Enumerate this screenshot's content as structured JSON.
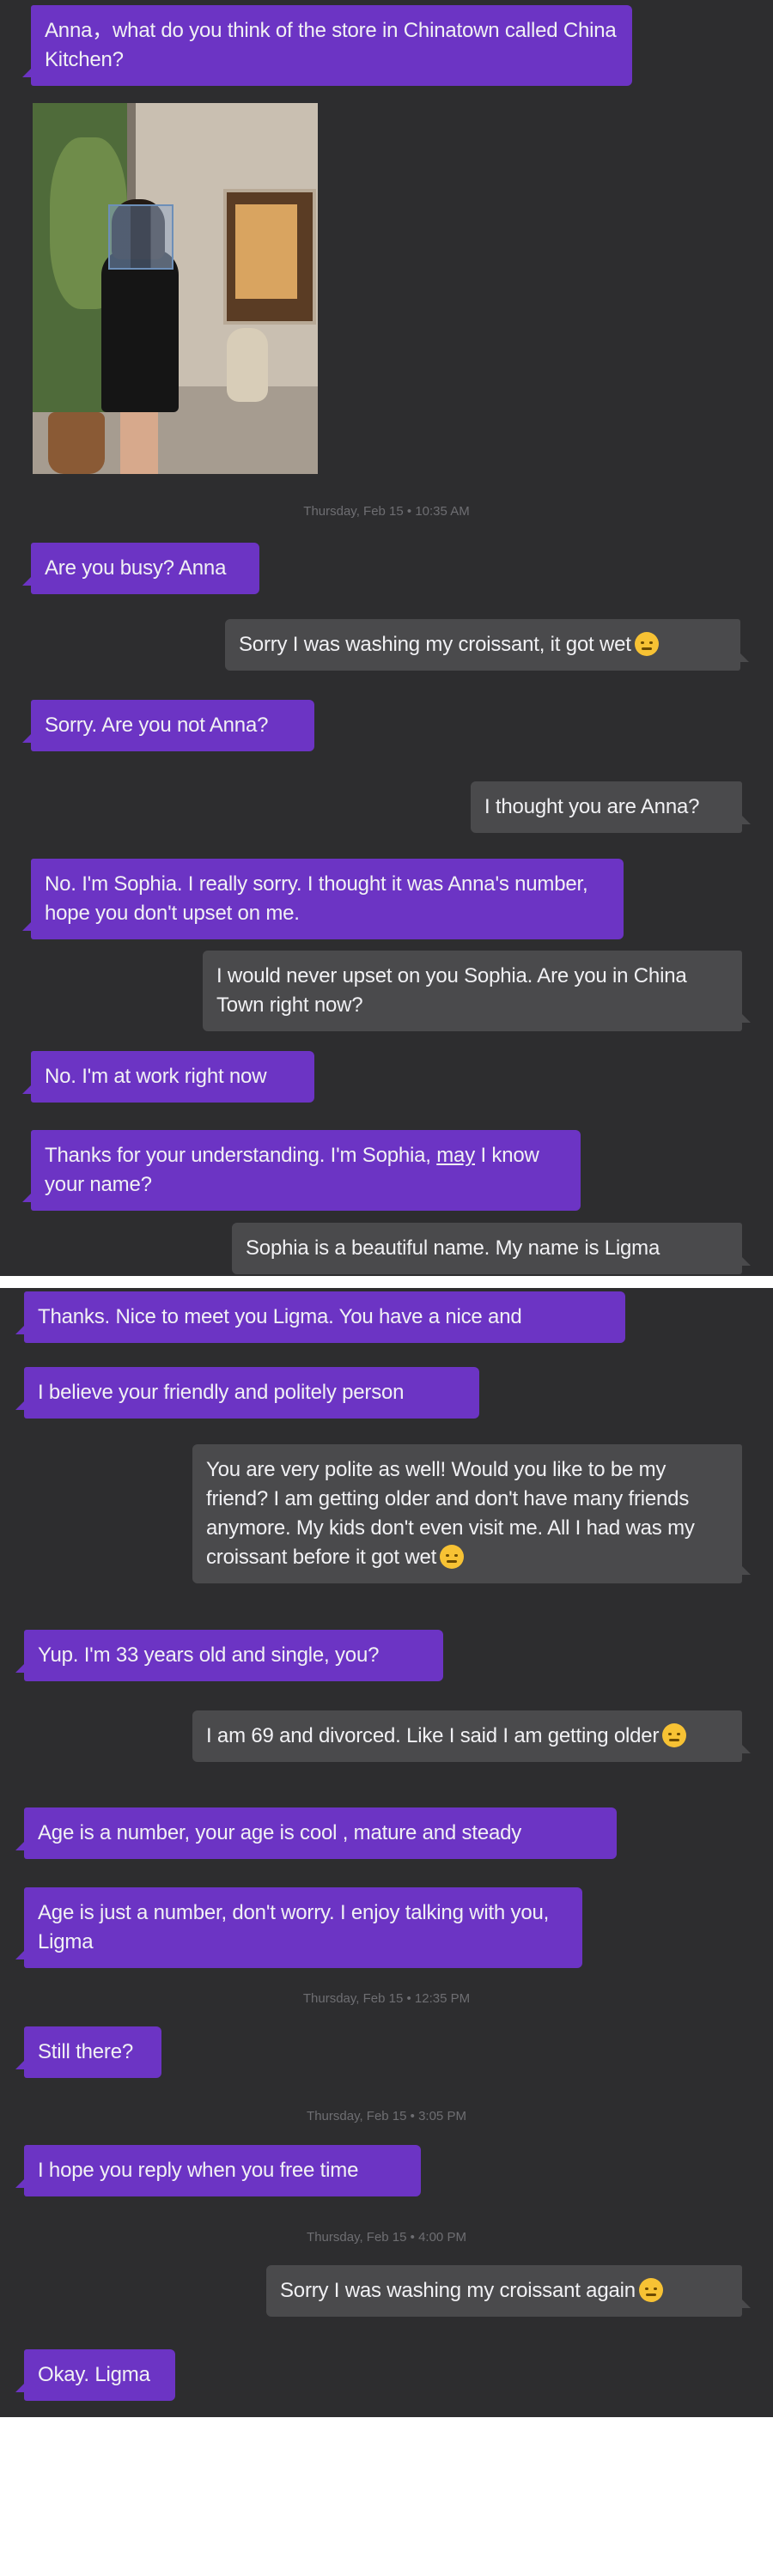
{
  "panel1": {
    "messages": [
      {
        "dir": "in",
        "text": "Anna，what do you think of the store in Chinatown called China Kitchen?"
      },
      {
        "dir": "in",
        "text": "Are you busy? Anna"
      },
      {
        "dir": "out",
        "text": "Sorry I was washing my croissant, it got wet",
        "emoji": "pensive-face-icon"
      },
      {
        "dir": "in",
        "text": "Sorry. Are you not Anna?"
      },
      {
        "dir": "out",
        "text": "I thought you are Anna?"
      },
      {
        "dir": "in",
        "text": "No. I'm Sophia. I really sorry. I thought it was Anna's number, hope you don't upset on me."
      },
      {
        "dir": "out",
        "text": "I would never upset on you Sophia. Are you in China Town right now?"
      },
      {
        "dir": "in",
        "text": "No. I'm at work right now"
      },
      {
        "dir": "in",
        "text_before": "Thanks for your understanding. I'm Sophia, ",
        "text_underlined": "may",
        "text_after": " I know your name?"
      },
      {
        "dir": "out",
        "text": "Sophia is a beautiful name. My name is Ligma"
      }
    ],
    "timestamps": [
      "Thursday, Feb 15 • 10:35 AM"
    ],
    "photo_icon": "photo-of-woman-face-blurred"
  },
  "panel2": {
    "messages": [
      {
        "dir": "in",
        "text": "Thanks. Nice to meet you Ligma. You have a nice and"
      },
      {
        "dir": "in",
        "text": "I believe your friendly and politely person"
      },
      {
        "dir": "out",
        "text": "You are very polite as well! Would you like to be my friend? I am getting older and don't have many friends anymore. My kids don't even visit me. All I had was my croissant before it got wet",
        "emoji": "pensive-face-icon"
      },
      {
        "dir": "in",
        "text": "Yup. I'm 33 years old and single, you?"
      },
      {
        "dir": "out",
        "text": "I am 69 and divorced. Like I said I am getting older",
        "emoji": "tired-face-icon"
      },
      {
        "dir": "in",
        "text": "Age is a number, your age is cool , mature and steady"
      },
      {
        "dir": "in",
        "text": "Age is just a number, don't worry. I enjoy talking with you, Ligma"
      },
      {
        "dir": "in",
        "text": "Still there?"
      },
      {
        "dir": "in",
        "text": "I hope you reply when you free time"
      },
      {
        "dir": "out",
        "text": "Sorry I was washing my croissant again",
        "emoji": "pensive-face-icon"
      },
      {
        "dir": "in",
        "text": "Okay. Ligma"
      }
    ],
    "timestamps": [
      "Thursday, Feb 15 • 12:35 PM",
      "Thursday, Feb 15 • 3:05 PM",
      "Thursday, Feb 15 • 4:00 PM"
    ]
  },
  "colors": {
    "background": "#2d2d2f",
    "incoming_bubble": "#6c34c4",
    "outgoing_bubble": "#4a4a4c",
    "text": "#f1f1f4",
    "timestamp": "#6e6e72"
  }
}
